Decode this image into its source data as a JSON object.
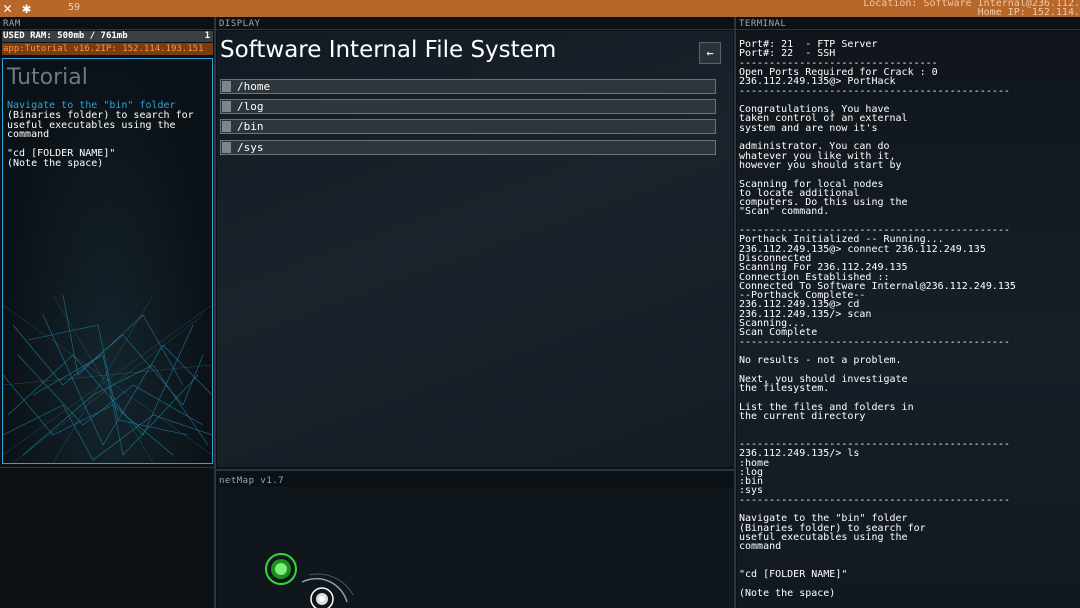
{
  "topbar": {
    "close_icon": "close-icon",
    "settings_icon": "gear-icon",
    "fps": "59",
    "location": "Location: Software Internal@236.112.",
    "home_ip": "Home IP: 152.114."
  },
  "labels": {
    "ram": "RAM",
    "display": "DISPLAY",
    "terminal": "TERMINAL",
    "netmap": "netMap v1.7"
  },
  "ram": {
    "used": "USED RAM: 500mb / 761mb",
    "count": "1",
    "app": "app:Tutorial v16.2IP: 152.114.193.151"
  },
  "tutorial": {
    "title": "Tutorial",
    "highlight": "Navigate to the \"bin\" folder",
    "body": "(Binaries folder) to search for useful executables using the command",
    "cmd_1": "\"cd [FOLDER NAME]\"",
    "cmd_2": "(Note the space)"
  },
  "display": {
    "title": "Software Internal File System",
    "back_label": "←",
    "folders": [
      "/home",
      "/log",
      "/bin",
      "/sys"
    ]
  },
  "terminal": {
    "lines": [
      "Port#: 21  - FTP Server",
      "Port#: 22  - SSH",
      "---------------------------------",
      "Open Ports Required for Crack : 0",
      "236.112.249.135@> PortHack",
      "---------------------------------------------",
      "",
      "Congratulations, You have",
      "taken control of an external",
      "system and are now it's",
      "",
      "administrator. You can do",
      "whatever you like with it,",
      "however you should start by",
      "",
      "Scanning for local nodes",
      "to locate additional",
      "computers. Do this using the",
      "\"Scan\" command.",
      "",
      "---------------------------------------------",
      "Porthack Initialized -- Running...",
      "236.112.249.135@> connect 236.112.249.135",
      "Disconnected",
      "Scanning For 236.112.249.135",
      "Connection Established ::",
      "Connected To Software Internal@236.112.249.135",
      "--Porthack Complete--",
      "236.112.249.135@> cd",
      "236.112.249.135/> scan",
      "Scanning...",
      "Scan Complete",
      "---------------------------------------------",
      "",
      "No results - not a problem.",
      "",
      "Next, you should investigate",
      "the filesystem.",
      "",
      "List the files and folders in",
      "the current directory",
      "",
      "",
      "---------------------------------------------",
      "236.112.249.135/> ls",
      ":home",
      ":log",
      ":bin",
      ":sys",
      "---------------------------------------------",
      "",
      "Navigate to the \"bin\" folder",
      "(Binaries folder) to search for",
      "useful executables using the",
      "command",
      "",
      "",
      "\"cd [FOLDER NAME]\"",
      "",
      "(Note the space)"
    ]
  },
  "netmap": {
    "nodes": [
      "home-node",
      "target-node"
    ]
  }
}
